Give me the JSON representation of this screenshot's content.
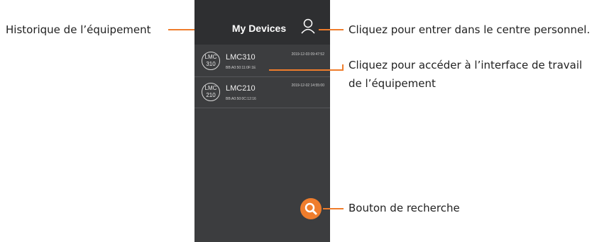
{
  "app": {
    "title": "My Devices",
    "user_icon": "person-icon",
    "search_icon": "magnifier-icon"
  },
  "devices": [
    {
      "badge_top": "LMC",
      "badge_bottom": "310",
      "name": "LMC310",
      "mac": "BB:A0:50:11:0F:1E",
      "timestamp": "2019-12-03 09:47:52"
    },
    {
      "badge_top": "LMC",
      "badge_bottom": "210",
      "name": "LMC210",
      "mac": "BB:A0:50:0C:12:16",
      "timestamp": "2019-12-02 14:55:00"
    }
  ],
  "callouts": {
    "history": "Historique de l’équipement",
    "personal_center": "Cliquez pour entrer dans le centre personnel.",
    "work_interface_line1": "Cliquez pour accéder à l’interface de travail",
    "work_interface_line2": "de l’équipement",
    "search": "Bouton de recherche"
  },
  "colors": {
    "accent": "#ef7d2c",
    "header": "#2e2f31",
    "panel": "#3c3d3f"
  }
}
